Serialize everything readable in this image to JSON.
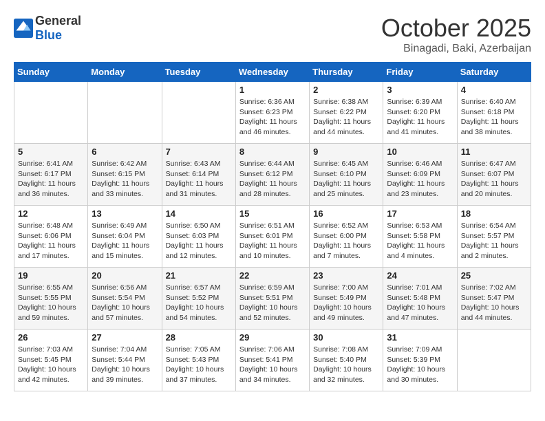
{
  "header": {
    "logo_general": "General",
    "logo_blue": "Blue",
    "month": "October 2025",
    "location": "Binagadi, Baki, Azerbaijan"
  },
  "weekdays": [
    "Sunday",
    "Monday",
    "Tuesday",
    "Wednesday",
    "Thursday",
    "Friday",
    "Saturday"
  ],
  "weeks": [
    [
      {
        "day": "",
        "info": ""
      },
      {
        "day": "",
        "info": ""
      },
      {
        "day": "",
        "info": ""
      },
      {
        "day": "1",
        "info": "Sunrise: 6:36 AM\nSunset: 6:23 PM\nDaylight: 11 hours\nand 46 minutes."
      },
      {
        "day": "2",
        "info": "Sunrise: 6:38 AM\nSunset: 6:22 PM\nDaylight: 11 hours\nand 44 minutes."
      },
      {
        "day": "3",
        "info": "Sunrise: 6:39 AM\nSunset: 6:20 PM\nDaylight: 11 hours\nand 41 minutes."
      },
      {
        "day": "4",
        "info": "Sunrise: 6:40 AM\nSunset: 6:18 PM\nDaylight: 11 hours\nand 38 minutes."
      }
    ],
    [
      {
        "day": "5",
        "info": "Sunrise: 6:41 AM\nSunset: 6:17 PM\nDaylight: 11 hours\nand 36 minutes."
      },
      {
        "day": "6",
        "info": "Sunrise: 6:42 AM\nSunset: 6:15 PM\nDaylight: 11 hours\nand 33 minutes."
      },
      {
        "day": "7",
        "info": "Sunrise: 6:43 AM\nSunset: 6:14 PM\nDaylight: 11 hours\nand 31 minutes."
      },
      {
        "day": "8",
        "info": "Sunrise: 6:44 AM\nSunset: 6:12 PM\nDaylight: 11 hours\nand 28 minutes."
      },
      {
        "day": "9",
        "info": "Sunrise: 6:45 AM\nSunset: 6:10 PM\nDaylight: 11 hours\nand 25 minutes."
      },
      {
        "day": "10",
        "info": "Sunrise: 6:46 AM\nSunset: 6:09 PM\nDaylight: 11 hours\nand 23 minutes."
      },
      {
        "day": "11",
        "info": "Sunrise: 6:47 AM\nSunset: 6:07 PM\nDaylight: 11 hours\nand 20 minutes."
      }
    ],
    [
      {
        "day": "12",
        "info": "Sunrise: 6:48 AM\nSunset: 6:06 PM\nDaylight: 11 hours\nand 17 minutes."
      },
      {
        "day": "13",
        "info": "Sunrise: 6:49 AM\nSunset: 6:04 PM\nDaylight: 11 hours\nand 15 minutes."
      },
      {
        "day": "14",
        "info": "Sunrise: 6:50 AM\nSunset: 6:03 PM\nDaylight: 11 hours\nand 12 minutes."
      },
      {
        "day": "15",
        "info": "Sunrise: 6:51 AM\nSunset: 6:01 PM\nDaylight: 11 hours\nand 10 minutes."
      },
      {
        "day": "16",
        "info": "Sunrise: 6:52 AM\nSunset: 6:00 PM\nDaylight: 11 hours\nand 7 minutes."
      },
      {
        "day": "17",
        "info": "Sunrise: 6:53 AM\nSunset: 5:58 PM\nDaylight: 11 hours\nand 4 minutes."
      },
      {
        "day": "18",
        "info": "Sunrise: 6:54 AM\nSunset: 5:57 PM\nDaylight: 11 hours\nand 2 minutes."
      }
    ],
    [
      {
        "day": "19",
        "info": "Sunrise: 6:55 AM\nSunset: 5:55 PM\nDaylight: 10 hours\nand 59 minutes."
      },
      {
        "day": "20",
        "info": "Sunrise: 6:56 AM\nSunset: 5:54 PM\nDaylight: 10 hours\nand 57 minutes."
      },
      {
        "day": "21",
        "info": "Sunrise: 6:57 AM\nSunset: 5:52 PM\nDaylight: 10 hours\nand 54 minutes."
      },
      {
        "day": "22",
        "info": "Sunrise: 6:59 AM\nSunset: 5:51 PM\nDaylight: 10 hours\nand 52 minutes."
      },
      {
        "day": "23",
        "info": "Sunrise: 7:00 AM\nSunset: 5:49 PM\nDaylight: 10 hours\nand 49 minutes."
      },
      {
        "day": "24",
        "info": "Sunrise: 7:01 AM\nSunset: 5:48 PM\nDaylight: 10 hours\nand 47 minutes."
      },
      {
        "day": "25",
        "info": "Sunrise: 7:02 AM\nSunset: 5:47 PM\nDaylight: 10 hours\nand 44 minutes."
      }
    ],
    [
      {
        "day": "26",
        "info": "Sunrise: 7:03 AM\nSunset: 5:45 PM\nDaylight: 10 hours\nand 42 minutes."
      },
      {
        "day": "27",
        "info": "Sunrise: 7:04 AM\nSunset: 5:44 PM\nDaylight: 10 hours\nand 39 minutes."
      },
      {
        "day": "28",
        "info": "Sunrise: 7:05 AM\nSunset: 5:43 PM\nDaylight: 10 hours\nand 37 minutes."
      },
      {
        "day": "29",
        "info": "Sunrise: 7:06 AM\nSunset: 5:41 PM\nDaylight: 10 hours\nand 34 minutes."
      },
      {
        "day": "30",
        "info": "Sunrise: 7:08 AM\nSunset: 5:40 PM\nDaylight: 10 hours\nand 32 minutes."
      },
      {
        "day": "31",
        "info": "Sunrise: 7:09 AM\nSunset: 5:39 PM\nDaylight: 10 hours\nand 30 minutes."
      },
      {
        "day": "",
        "info": ""
      }
    ]
  ]
}
